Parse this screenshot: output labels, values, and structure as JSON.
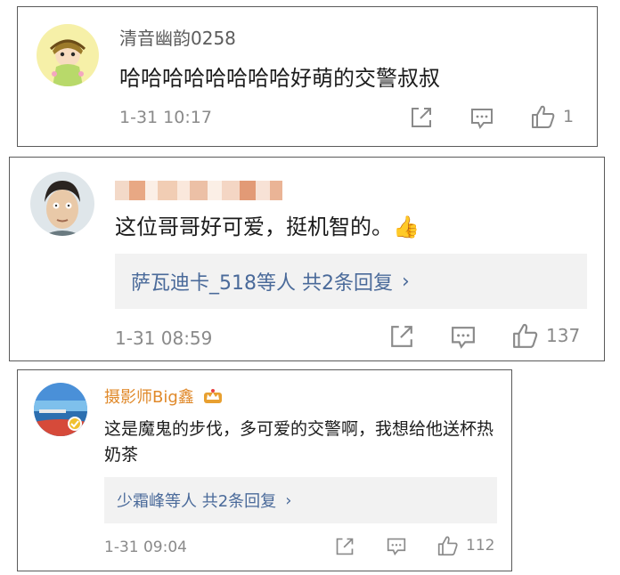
{
  "comments": [
    {
      "username": "清音幽韵0258",
      "content": "哈哈哈哈哈哈哈哈好萌的交警叔叔",
      "time": "1-31 10:17",
      "like_count": "1",
      "avatar_icon": "cartoon-girl-avatar"
    },
    {
      "username": "",
      "content": "这位哥哥好可爱，挺机智的。👍",
      "replies_text": "萨瓦迪卡_518等人  共2条回复",
      "time": "1-31 08:59",
      "like_count": "137",
      "avatar_icon": "man-portrait-avatar"
    },
    {
      "username": "摄影师Big鑫",
      "content": "这是魔鬼的步伐，多可爱的交警啊，我想给他送杯热奶茶",
      "replies_text": "少霜峰等人  共2条回复",
      "time": "1-31 09:04",
      "like_count": "112",
      "avatar_icon": "beach-landscape-avatar"
    }
  ],
  "colors": {
    "username_gold": "#e0892a",
    "link_blue": "#4a6a9a",
    "meta_gray": "#8a8a8a"
  },
  "chevron": "›"
}
